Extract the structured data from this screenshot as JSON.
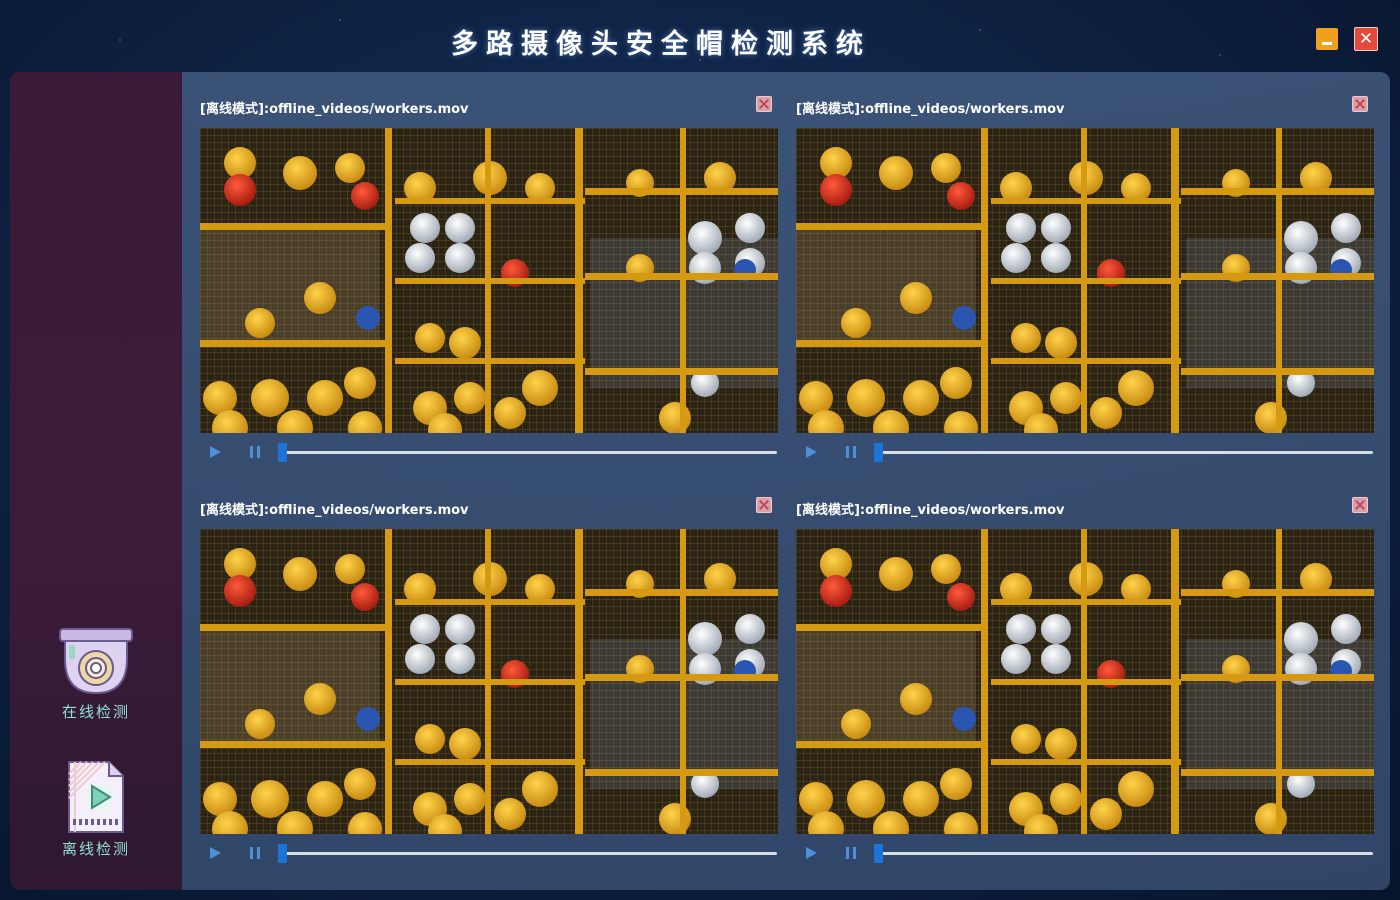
{
  "app": {
    "title": "多路摄像头安全帽检测系统",
    "minimize_icon": "minimize-icon",
    "close_glyph": "✕"
  },
  "sidebar": {
    "items": [
      {
        "label": "在线检测",
        "icon": "camera-icon"
      },
      {
        "label": "离线检测",
        "icon": "video-file-icon"
      }
    ]
  },
  "panels": [
    {
      "title": "[离线模式]:offline_videos/workers.mov",
      "progress": 0.0
    },
    {
      "title": "[离线模式]:offline_videos/workers.mov",
      "progress": 0.0
    },
    {
      "title": "[离线模式]:offline_videos/workers.mov",
      "progress": 0.0
    },
    {
      "title": "[离线模式]:offline_videos/workers.mov",
      "progress": 0.0
    }
  ],
  "colors": {
    "accent": "#1e73d6",
    "sidebar_label": "#8fe0cf",
    "minimize": "#f0a01e",
    "close": "#e24a3a"
  }
}
